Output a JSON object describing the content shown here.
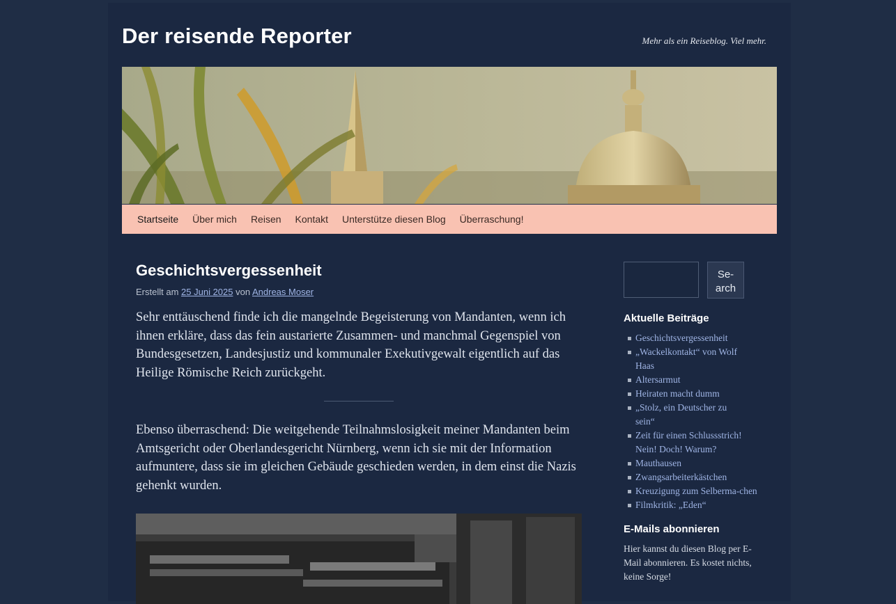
{
  "site": {
    "title": "Der reisende Reporter",
    "description": "Mehr als ein Reiseblog. Viel mehr."
  },
  "nav": {
    "items": [
      "Startseite",
      "Über mich",
      "Reisen",
      "Kontakt",
      "Unterstütze diesen Blog",
      "Überraschung!"
    ],
    "active": "Startseite"
  },
  "post": {
    "title": "Geschichtsvergessenheit",
    "meta_prefix": "Erstellt am",
    "date": "25 Juni 2025",
    "meta_by": "von",
    "author": "Andreas Moser",
    "paragraph1": "Sehr enttäuschend finde ich die mangelnde Begeisterung von Mandanten, wenn ich ihnen erkläre, dass das fein austarierte Zusammen- und manchmal Gegenspiel von Bundesgesetzen, Landesjustiz und kommunaler Exekutivgewalt eigentlich auf das Heilige Römische Reich zurückgeht.",
    "paragraph2": "Ebenso überraschend: Die weitgehende Teilnahmslosigkeit meiner Mandanten beim Amtsgericht oder Oberlandesgericht Nürnberg, wenn ich sie mit der Information aufmuntere, dass sie im gleichen Gebäude geschieden werden, in dem einst die Nazis gehenkt wurden."
  },
  "sidebar": {
    "search_button": "Se-\narch",
    "recent_title": "Aktuelle Beiträge",
    "recent_posts": [
      "Geschichtsvergessenheit",
      "„Wackelkontakt“ von Wolf Haas",
      "Altersarmut",
      "Heiraten macht dumm",
      "„Stolz, ein Deutscher zu sein“",
      "Zeit für einen Schlussstrich! Nein! Doch! Warum?",
      "Mauthausen",
      "Zwangsarbeiterkästchen",
      "Kreuzigung zum Selberma-chen",
      "Filmkritik: „Eden“"
    ],
    "subscribe_title": "E-Mails abonnieren",
    "subscribe_text": "Hier kannst du diesen Blog per E-Mail abonnieren. Es kostet nichts, keine Sorge!"
  },
  "colors": {
    "background": "#1f2d45",
    "nav_background": "#f9c2b2",
    "link": "#9fb4e4"
  }
}
